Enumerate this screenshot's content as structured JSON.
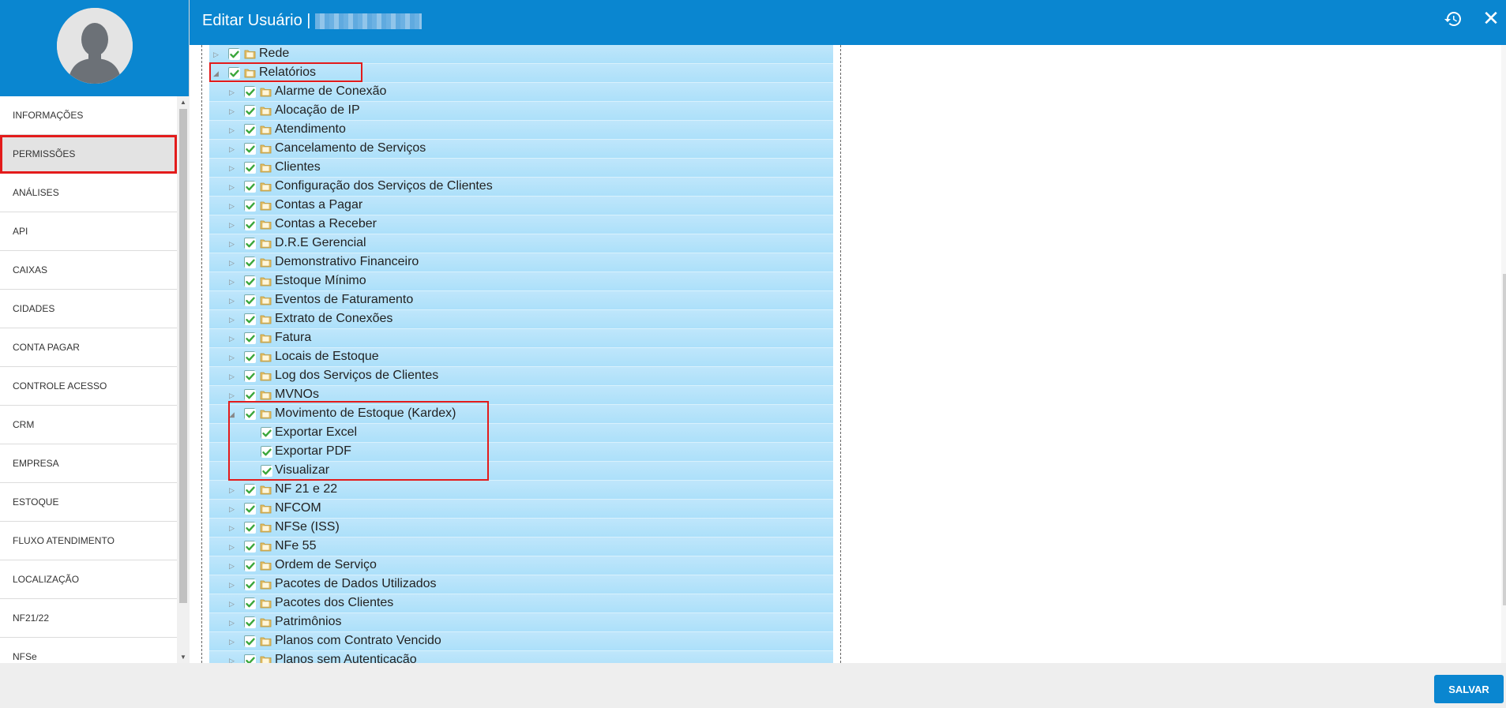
{
  "header": {
    "title": "Editar Usuário |"
  },
  "sidebar": {
    "items": [
      {
        "label": "INFORMAÇÕES"
      },
      {
        "label": "PERMISSÕES"
      },
      {
        "label": "ANÁLISES"
      },
      {
        "label": "API"
      },
      {
        "label": "CAIXAS"
      },
      {
        "label": "CIDADES"
      },
      {
        "label": "CONTA PAGAR"
      },
      {
        "label": "CONTROLE ACESSO"
      },
      {
        "label": "CRM"
      },
      {
        "label": "EMPRESA"
      },
      {
        "label": "ESTOQUE"
      },
      {
        "label": "FLUXO ATENDIMENTO"
      },
      {
        "label": "LOCALIZAÇÃO"
      },
      {
        "label": "NF21/22"
      },
      {
        "label": "NFSe"
      }
    ],
    "active": "PERMISSÕES"
  },
  "tree": {
    "rows": [
      {
        "label": "Rede",
        "level": 0,
        "expanded": false,
        "folder": true,
        "checked": true
      },
      {
        "label": "Relatórios",
        "level": 0,
        "expanded": true,
        "folder": true,
        "checked": true
      },
      {
        "label": "Alarme de Conexão",
        "level": 1,
        "expanded": false,
        "folder": true,
        "checked": true
      },
      {
        "label": "Alocação de IP",
        "level": 1,
        "expanded": false,
        "folder": true,
        "checked": true
      },
      {
        "label": "Atendimento",
        "level": 1,
        "expanded": false,
        "folder": true,
        "checked": true
      },
      {
        "label": "Cancelamento de Serviços",
        "level": 1,
        "expanded": false,
        "folder": true,
        "checked": true
      },
      {
        "label": "Clientes",
        "level": 1,
        "expanded": false,
        "folder": true,
        "checked": true
      },
      {
        "label": "Configuração dos Serviços de Clientes",
        "level": 1,
        "expanded": false,
        "folder": true,
        "checked": true
      },
      {
        "label": "Contas a Pagar",
        "level": 1,
        "expanded": false,
        "folder": true,
        "checked": true
      },
      {
        "label": "Contas a Receber",
        "level": 1,
        "expanded": false,
        "folder": true,
        "checked": true
      },
      {
        "label": "D.R.E Gerencial",
        "level": 1,
        "expanded": false,
        "folder": true,
        "checked": true
      },
      {
        "label": "Demonstrativo Financeiro",
        "level": 1,
        "expanded": false,
        "folder": true,
        "checked": true
      },
      {
        "label": "Estoque Mínimo",
        "level": 1,
        "expanded": false,
        "folder": true,
        "checked": true
      },
      {
        "label": "Eventos de Faturamento",
        "level": 1,
        "expanded": false,
        "folder": true,
        "checked": true
      },
      {
        "label": "Extrato de Conexões",
        "level": 1,
        "expanded": false,
        "folder": true,
        "checked": true
      },
      {
        "label": "Fatura",
        "level": 1,
        "expanded": false,
        "folder": true,
        "checked": true
      },
      {
        "label": "Locais de Estoque",
        "level": 1,
        "expanded": false,
        "folder": true,
        "checked": true
      },
      {
        "label": "Log dos Serviços de Clientes",
        "level": 1,
        "expanded": false,
        "folder": true,
        "checked": true
      },
      {
        "label": "MVNOs",
        "level": 1,
        "expanded": false,
        "folder": true,
        "checked": true
      },
      {
        "label": "Movimento de Estoque (Kardex)",
        "level": 1,
        "expanded": true,
        "folder": true,
        "checked": true
      },
      {
        "label": "Exportar Excel",
        "level": 2,
        "expanded": false,
        "folder": false,
        "checked": true
      },
      {
        "label": "Exportar PDF",
        "level": 2,
        "expanded": false,
        "folder": false,
        "checked": true
      },
      {
        "label": "Visualizar",
        "level": 2,
        "expanded": false,
        "folder": false,
        "checked": true
      },
      {
        "label": "NF 21 e 22",
        "level": 1,
        "expanded": false,
        "folder": true,
        "checked": true
      },
      {
        "label": "NFCOM",
        "level": 1,
        "expanded": false,
        "folder": true,
        "checked": true
      },
      {
        "label": "NFSe (ISS)",
        "level": 1,
        "expanded": false,
        "folder": true,
        "checked": true
      },
      {
        "label": "NFe 55",
        "level": 1,
        "expanded": false,
        "folder": true,
        "checked": true
      },
      {
        "label": "Ordem de Serviço",
        "level": 1,
        "expanded": false,
        "folder": true,
        "checked": true
      },
      {
        "label": "Pacotes de Dados Utilizados",
        "level": 1,
        "expanded": false,
        "folder": true,
        "checked": true
      },
      {
        "label": "Pacotes dos Clientes",
        "level": 1,
        "expanded": false,
        "folder": true,
        "checked": true
      },
      {
        "label": "Patrimônios",
        "level": 1,
        "expanded": false,
        "folder": true,
        "checked": true
      },
      {
        "label": "Planos com Contrato Vencido",
        "level": 1,
        "expanded": false,
        "folder": true,
        "checked": true
      },
      {
        "label": "Planos sem Autenticação",
        "level": 1,
        "expanded": false,
        "folder": true,
        "checked": true
      }
    ]
  },
  "footer": {
    "save_label": "SALVAR"
  },
  "colors": {
    "brand": "#0a86d0",
    "tree_row": "#b8e3fa",
    "highlight": "#e31b1b",
    "check": "#3aa63a"
  },
  "icons": {
    "history": "history-icon",
    "close": "close-icon",
    "folder": "folder-icon",
    "checkbox": "checkbox-checked-icon",
    "avatar": "user-avatar-icon"
  }
}
